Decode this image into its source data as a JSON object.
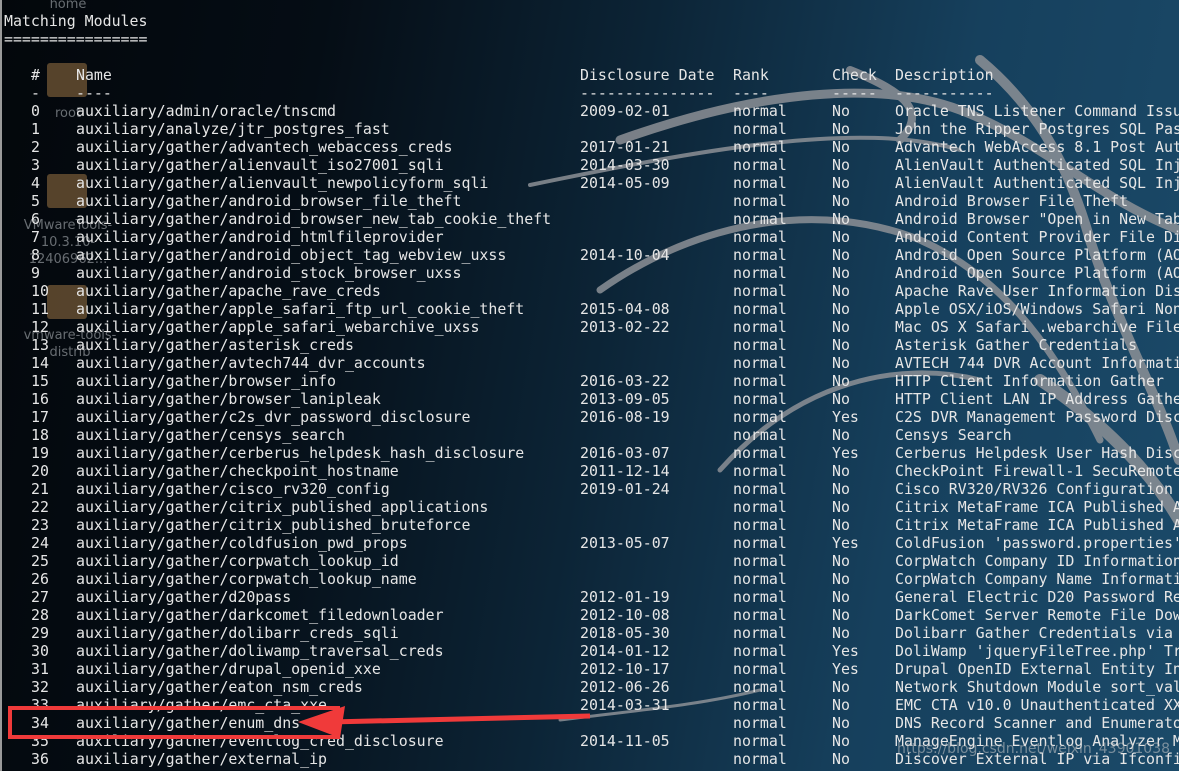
{
  "desktop_icons": [
    {
      "label": "home"
    },
    {
      "label": "root"
    },
    {
      "label": "VMwareTools-10.3.10-12406962..."
    },
    {
      "label": "vmware-tools-distrib"
    }
  ],
  "title": "Matching Modules",
  "underline": "================",
  "headers": {
    "num": "#",
    "name": "Name",
    "date": "Disclosure Date",
    "rank": "Rank",
    "check": "Check",
    "desc": "Description"
  },
  "header_dashes": {
    "num": "-",
    "name": "----",
    "date": "---------------",
    "rank": "----",
    "check": "-----",
    "desc": "-----------"
  },
  "modules": [
    {
      "num": "0",
      "name": "auxiliary/admin/oracle/tnscmd",
      "date": "2009-02-01",
      "rank": "normal",
      "check": "No",
      "desc": "Oracle TNS Listener Command Issu"
    },
    {
      "num": "1",
      "name": "auxiliary/analyze/jtr_postgres_fast",
      "date": "",
      "rank": "normal",
      "check": "No",
      "desc": "John the Ripper Postgres SQL Pas"
    },
    {
      "num": "2",
      "name": "auxiliary/gather/advantech_webaccess_creds",
      "date": "2017-01-21",
      "rank": "normal",
      "check": "No",
      "desc": "Advantech WebAccess 8.1 Post Aut"
    },
    {
      "num": "3",
      "name": "auxiliary/gather/alienvault_iso27001_sqli",
      "date": "2014-03-30",
      "rank": "normal",
      "check": "No",
      "desc": "AlienVault Authenticated SQL Inj"
    },
    {
      "num": "4",
      "name": "auxiliary/gather/alienvault_newpolicyform_sqli",
      "date": "2014-05-09",
      "rank": "normal",
      "check": "No",
      "desc": "AlienVault Authenticated SQL Inj"
    },
    {
      "num": "5",
      "name": "auxiliary/gather/android_browser_file_theft",
      "date": "",
      "rank": "normal",
      "check": "No",
      "desc": "Android Browser File Theft"
    },
    {
      "num": "6",
      "name": "auxiliary/gather/android_browser_new_tab_cookie_theft",
      "date": "",
      "rank": "normal",
      "check": "No",
      "desc": "Android Browser \"Open in New Tab"
    },
    {
      "num": "7",
      "name": "auxiliary/gather/android_htmlfileprovider",
      "date": "",
      "rank": "normal",
      "check": "No",
      "desc": "Android Content Provider File Di"
    },
    {
      "num": "8",
      "name": "auxiliary/gather/android_object_tag_webview_uxss",
      "date": "2014-10-04",
      "rank": "normal",
      "check": "No",
      "desc": "Android Open Source Platform (AO"
    },
    {
      "num": "9",
      "name": "auxiliary/gather/android_stock_browser_uxss",
      "date": "",
      "rank": "normal",
      "check": "No",
      "desc": "Android Open Source Platform (AO"
    },
    {
      "num": "10",
      "name": "auxiliary/gather/apache_rave_creds",
      "date": "",
      "rank": "normal",
      "check": "No",
      "desc": "Apache Rave User Information Dis"
    },
    {
      "num": "11",
      "name": "auxiliary/gather/apple_safari_ftp_url_cookie_theft",
      "date": "2015-04-08",
      "rank": "normal",
      "check": "No",
      "desc": "Apple OSX/iOS/Windows Safari Non"
    },
    {
      "num": "12",
      "name": "auxiliary/gather/apple_safari_webarchive_uxss",
      "date": "2013-02-22",
      "rank": "normal",
      "check": "No",
      "desc": "Mac OS X Safari .webarchive File"
    },
    {
      "num": "13",
      "name": "auxiliary/gather/asterisk_creds",
      "date": "",
      "rank": "normal",
      "check": "No",
      "desc": "Asterisk Gather Credentials"
    },
    {
      "num": "14",
      "name": "auxiliary/gather/avtech744_dvr_accounts",
      "date": "",
      "rank": "normal",
      "check": "No",
      "desc": "AVTECH 744 DVR Account Informati"
    },
    {
      "num": "15",
      "name": "auxiliary/gather/browser_info",
      "date": "2016-03-22",
      "rank": "normal",
      "check": "No",
      "desc": "HTTP Client Information Gather"
    },
    {
      "num": "16",
      "name": "auxiliary/gather/browser_lanipleak",
      "date": "2013-09-05",
      "rank": "normal",
      "check": "No",
      "desc": "HTTP Client LAN IP Address Gathe"
    },
    {
      "num": "17",
      "name": "auxiliary/gather/c2s_dvr_password_disclosure",
      "date": "2016-08-19",
      "rank": "normal",
      "check": "Yes",
      "desc": "C2S DVR Management Password Disc"
    },
    {
      "num": "18",
      "name": "auxiliary/gather/censys_search",
      "date": "",
      "rank": "normal",
      "check": "No",
      "desc": "Censys Search"
    },
    {
      "num": "19",
      "name": "auxiliary/gather/cerberus_helpdesk_hash_disclosure",
      "date": "2016-03-07",
      "rank": "normal",
      "check": "Yes",
      "desc": "Cerberus Helpdesk User Hash Disc"
    },
    {
      "num": "20",
      "name": "auxiliary/gather/checkpoint_hostname",
      "date": "2011-12-14",
      "rank": "normal",
      "check": "No",
      "desc": "CheckPoint Firewall-1 SecuRemote"
    },
    {
      "num": "21",
      "name": "auxiliary/gather/cisco_rv320_config",
      "date": "2019-01-24",
      "rank": "normal",
      "check": "No",
      "desc": "Cisco RV320/RV326 Configuration "
    },
    {
      "num": "22",
      "name": "auxiliary/gather/citrix_published_applications",
      "date": "",
      "rank": "normal",
      "check": "No",
      "desc": "Citrix MetaFrame ICA Published A"
    },
    {
      "num": "23",
      "name": "auxiliary/gather/citrix_published_bruteforce",
      "date": "",
      "rank": "normal",
      "check": "No",
      "desc": "Citrix MetaFrame ICA Published A"
    },
    {
      "num": "24",
      "name": "auxiliary/gather/coldfusion_pwd_props",
      "date": "2013-05-07",
      "rank": "normal",
      "check": "Yes",
      "desc": "ColdFusion 'password.properties'"
    },
    {
      "num": "25",
      "name": "auxiliary/gather/corpwatch_lookup_id",
      "date": "",
      "rank": "normal",
      "check": "No",
      "desc": "CorpWatch Company ID Information"
    },
    {
      "num": "26",
      "name": "auxiliary/gather/corpwatch_lookup_name",
      "date": "",
      "rank": "normal",
      "check": "No",
      "desc": "CorpWatch Company Name Informati"
    },
    {
      "num": "27",
      "name": "auxiliary/gather/d20pass",
      "date": "2012-01-19",
      "rank": "normal",
      "check": "No",
      "desc": "General Electric D20 Password Re"
    },
    {
      "num": "28",
      "name": "auxiliary/gather/darkcomet_filedownloader",
      "date": "2012-10-08",
      "rank": "normal",
      "check": "No",
      "desc": "DarkComet Server Remote File Dow"
    },
    {
      "num": "29",
      "name": "auxiliary/gather/dolibarr_creds_sqli",
      "date": "2018-05-30",
      "rank": "normal",
      "check": "No",
      "desc": "Dolibarr Gather Credentials via "
    },
    {
      "num": "30",
      "name": "auxiliary/gather/doliwamp_traversal_creds",
      "date": "2014-01-12",
      "rank": "normal",
      "check": "Yes",
      "desc": "DoliWamp 'jqueryFileTree.php' Tr"
    },
    {
      "num": "31",
      "name": "auxiliary/gather/drupal_openid_xxe",
      "date": "2012-10-17",
      "rank": "normal",
      "check": "Yes",
      "desc": "Drupal OpenID External Entity In"
    },
    {
      "num": "32",
      "name": "auxiliary/gather/eaton_nsm_creds",
      "date": "2012-06-26",
      "rank": "normal",
      "check": "No",
      "desc": "Network Shutdown Module sort_val"
    },
    {
      "num": "33",
      "name": "auxiliary/gather/emc_cta_xxe",
      "date": "2014-03-31",
      "rank": "normal",
      "check": "No",
      "desc": "EMC CTA v10.0 Unauthenticated XX"
    },
    {
      "num": "34",
      "name": "auxiliary/gather/enum_dns",
      "date": "",
      "rank": "normal",
      "check": "No",
      "desc": "DNS Record Scanner and Enumerato"
    },
    {
      "num": "35",
      "name": "auxiliary/gather/eventlog_cred_disclosure",
      "date": "2014-11-05",
      "rank": "normal",
      "check": "No",
      "desc": "ManageEngine Eventlog Analyzer M"
    },
    {
      "num": "36",
      "name": "auxiliary/gather/external_ip",
      "date": "",
      "rank": "normal",
      "check": "No",
      "desc": "Discover External IP via Ifconfi"
    }
  ],
  "highlight": {
    "row": "34",
    "color": "#f03a3a"
  },
  "watermark": "https://blog.csdn.net/weixin_43901038"
}
